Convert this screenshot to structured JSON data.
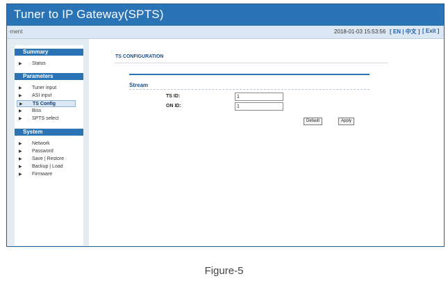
{
  "window": {
    "title": "Tuner to IP Gateway(SPTS)"
  },
  "statusbar": {
    "breadcrumb": "·ment",
    "datetime": "2018-01-03 15:53:56",
    "lang": "[ EN | 中文 ]",
    "exit": "[ Exit ]"
  },
  "sidebar": {
    "groups": [
      {
        "label": "Summary",
        "items": [
          {
            "label": "Status"
          }
        ]
      },
      {
        "label": "Parameters",
        "items": [
          {
            "label": "Tuner input"
          },
          {
            "label": "ASI input"
          },
          {
            "label": "TS Config"
          },
          {
            "label": "Biss"
          },
          {
            "label": "SPTS select"
          }
        ]
      },
      {
        "label": "System",
        "items": [
          {
            "label": "Network"
          },
          {
            "label": "Password"
          },
          {
            "label": "Save | Restore"
          },
          {
            "label": "Backup | Load"
          },
          {
            "label": "Firmware"
          }
        ]
      }
    ],
    "active_item": "TS Config"
  },
  "main": {
    "section_title": "TS CONFIGURATION",
    "panel_title": "Stream",
    "fields": [
      {
        "label": "TS ID:",
        "value": "1"
      },
      {
        "label": "ON ID:",
        "value": "1"
      }
    ],
    "buttons": {
      "default": "Default",
      "apply": "Apply"
    }
  },
  "caption": "Figure-5",
  "colors": {
    "brand_blue": "#2a73b5",
    "status_bg": "#dbe7f2",
    "sidebar_bg": "#e3ebf3"
  }
}
